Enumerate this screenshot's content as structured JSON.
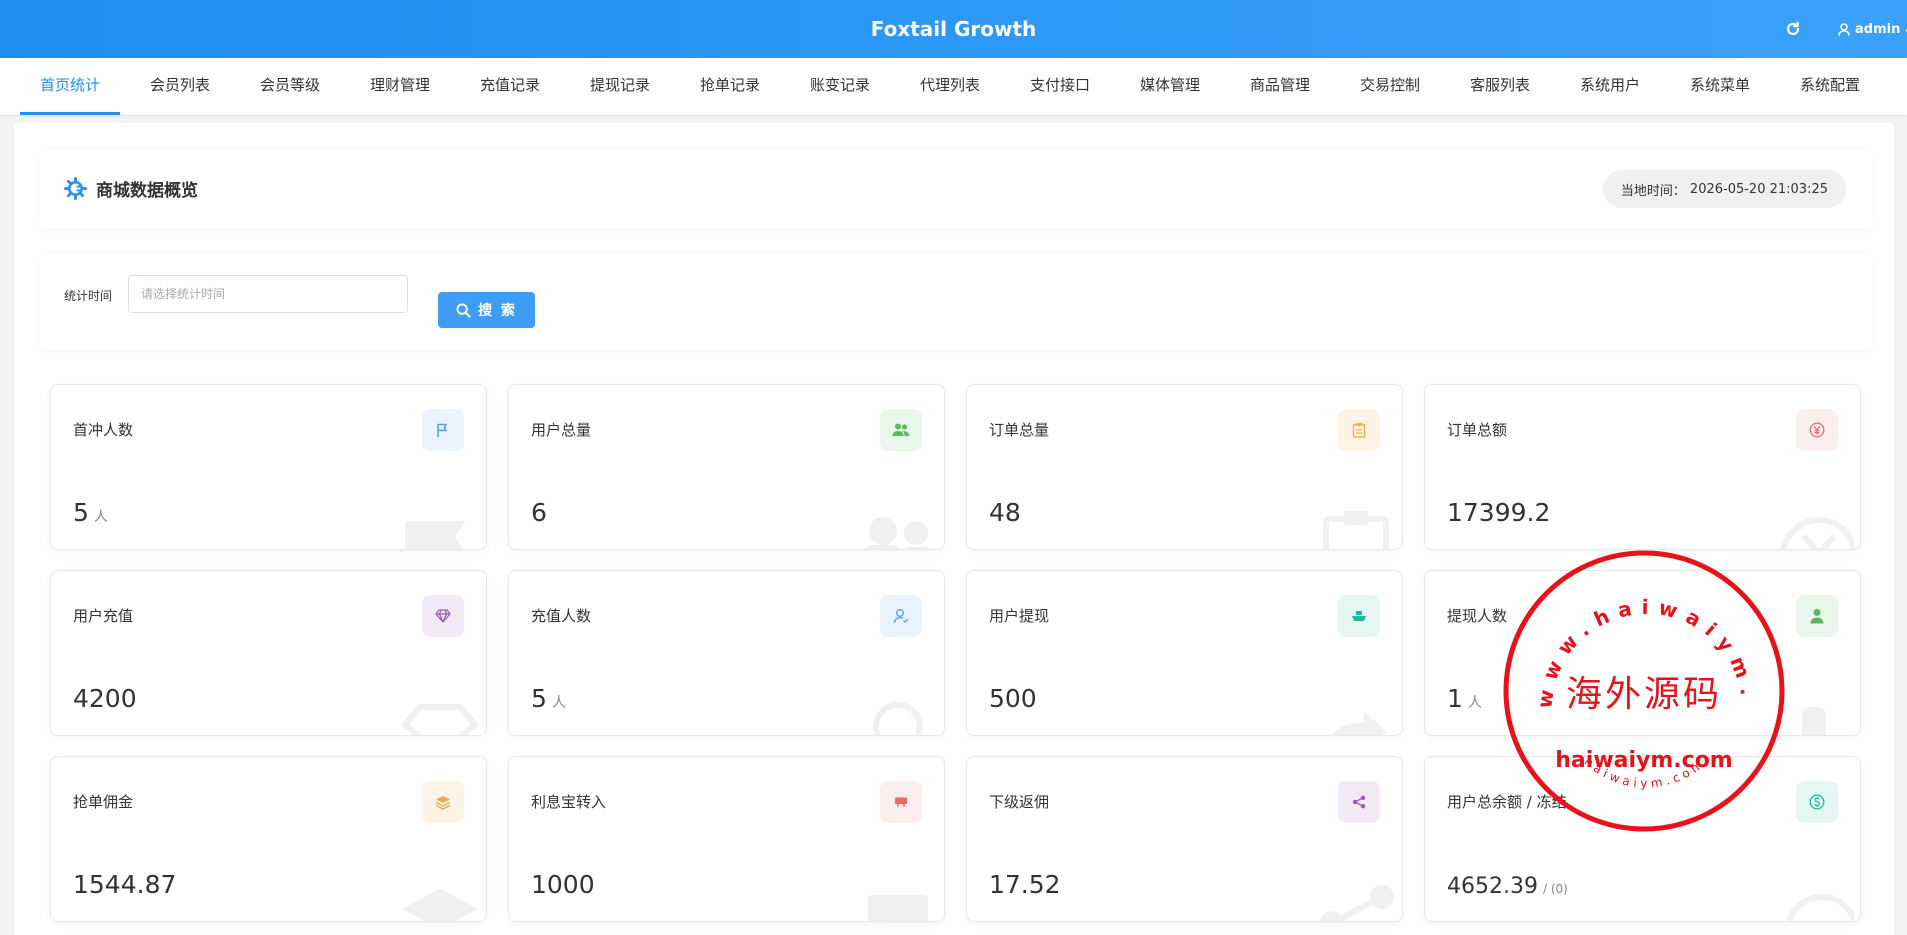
{
  "header": {
    "brand": "Foxtail Growth",
    "user": "admin"
  },
  "nav": {
    "tabs": [
      {
        "label": "首页统计",
        "active": true
      },
      {
        "label": "会员列表"
      },
      {
        "label": "会员等级"
      },
      {
        "label": "理财管理"
      },
      {
        "label": "充值记录"
      },
      {
        "label": "提现记录"
      },
      {
        "label": "抢单记录"
      },
      {
        "label": "账变记录"
      },
      {
        "label": "代理列表"
      },
      {
        "label": "支付接口"
      },
      {
        "label": "媒体管理"
      },
      {
        "label": "商品管理"
      },
      {
        "label": "交易控制"
      },
      {
        "label": "客服列表"
      },
      {
        "label": "系统用户"
      },
      {
        "label": "系统菜单"
      },
      {
        "label": "系统配置"
      }
    ]
  },
  "overview": {
    "title": "商城数据概览",
    "time_label": "当地时间：",
    "time_value": "2026-05-20 21:03:25"
  },
  "filter": {
    "label": "统计时间",
    "placeholder": "请选择统计时间",
    "value": "",
    "search_label": "搜 索"
  },
  "stats": [
    {
      "label": "首冲人数",
      "value": "5",
      "unit": "人",
      "icon": "flag-icon",
      "color": "#4a9ff5",
      "bg": "#eaf3fe"
    },
    {
      "label": "用户总量",
      "value": "6",
      "unit": "",
      "icon": "users-icon",
      "color": "#5cb85c",
      "bg": "#eaf6ea"
    },
    {
      "label": "订单总量",
      "value": "48",
      "unit": "",
      "icon": "clipboard-icon",
      "color": "#f0ad4e",
      "bg": "#fdf4e6"
    },
    {
      "label": "订单总额",
      "value": "17399.2",
      "unit": "",
      "icon": "yen-icon",
      "color": "#e66b6b",
      "bg": "#fdeeee"
    },
    {
      "label": "用户充值",
      "value": "4200",
      "unit": "",
      "icon": "diamond-icon",
      "color": "#9b59b6",
      "bg": "#f3eaf7"
    },
    {
      "label": "充值人数",
      "value": "5",
      "unit": "人",
      "icon": "user-outline-icon",
      "color": "#4a9ff5",
      "bg": "#eaf3fe"
    },
    {
      "label": "用户提现",
      "value": "500",
      "unit": "",
      "icon": "ship-icon",
      "color": "#1abc9c",
      "bg": "#e6f7f3"
    },
    {
      "label": "提现人数",
      "value": "1",
      "unit": "人",
      "icon": "user-icon",
      "color": "#5cb85c",
      "bg": "#eaf6ea"
    },
    {
      "label": "抢单佣金",
      "value": "1544.87",
      "unit": "",
      "icon": "layers-icon",
      "color": "#f0ad4e",
      "bg": "#fdf4e6"
    },
    {
      "label": "利息宝转入",
      "value": "1000",
      "unit": "",
      "icon": "sign-icon",
      "color": "#e66b6b",
      "bg": "#fdeeee"
    },
    {
      "label": "下级返佣",
      "value": "17.52",
      "unit": "",
      "icon": "share-icon",
      "color": "#9b59b6",
      "bg": "#f3eaf7"
    },
    {
      "label": "用户总余额 / 冻结",
      "value": "4652.39",
      "unit": "/ (0)",
      "icon": "dollar-icon",
      "color": "#1abc9c",
      "bg": "#e6f7f3"
    }
  ],
  "watermark": {
    "center_text": "海外源码",
    "domain_text": "haiwaiym.com",
    "ring_text": "www.haiwaiym.com",
    "small_text": "haiwaiym.com",
    "color": "#e8121b"
  }
}
